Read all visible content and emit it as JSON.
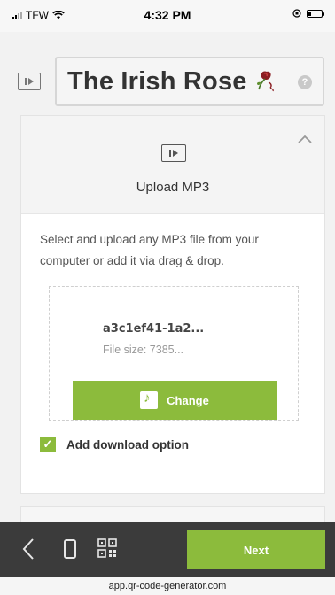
{
  "status_bar": {
    "carrier": "TFW",
    "time": "4:32 PM"
  },
  "header": {
    "title": "The Irish Rose",
    "help_label": "?"
  },
  "upload_card": {
    "title": "Upload MP3",
    "description": "Select and upload any MP3 file from your computer or add it via drag & drop.",
    "file_name": "a3c1ef41-1a2...",
    "file_size": "File size: 7385...",
    "change_label": "Change",
    "checkbox_checked": true,
    "checkbox_label": "Add download option"
  },
  "toolbar": {
    "next_label": "Next"
  },
  "browser": {
    "url": "app.qr-code-generator.com"
  },
  "colors": {
    "accent_green": "#8cbb3c",
    "toolbar_dark": "#3b3b3b"
  },
  "icons": [
    "signal-icon",
    "wifi-icon",
    "lock-rotation-icon",
    "battery-icon",
    "play-icon",
    "rose-emoji-icon",
    "help-icon",
    "chevron-up-icon",
    "music-file-icon",
    "checkmark-icon",
    "back-icon",
    "phone-preview-icon",
    "qr-code-icon"
  ]
}
